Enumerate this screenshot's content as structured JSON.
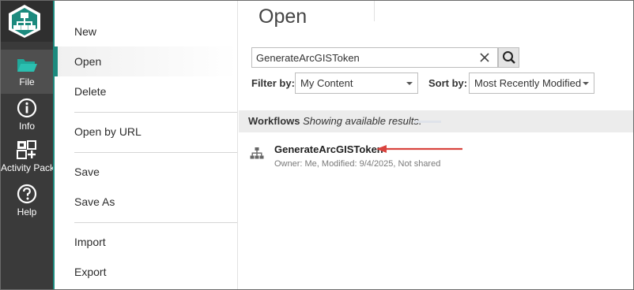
{
  "rail": {
    "items": [
      {
        "label": "File",
        "icon": "folder-icon"
      },
      {
        "label": "Info",
        "icon": "info-icon"
      },
      {
        "label": "Activity Packs",
        "icon": "activity-packs-icon"
      },
      {
        "label": "Help",
        "icon": "help-icon"
      }
    ],
    "logo_icon": "app-logo-icon",
    "accent_color": "#1c8a7e",
    "background_color": "#3a3a3a"
  },
  "menu": {
    "items": [
      {
        "label": "New"
      },
      {
        "label": "Open"
      },
      {
        "label": "Delete"
      },
      {
        "label": "Open by URL"
      },
      {
        "label": "Save"
      },
      {
        "label": "Save As"
      },
      {
        "label": "Import"
      },
      {
        "label": "Export"
      }
    ],
    "active": "Open"
  },
  "panel": {
    "title": "Open",
    "search": {
      "value": "GenerateArcGISToken"
    },
    "filter": {
      "label": "Filter by:",
      "value": "My Content"
    },
    "sort": {
      "label": "Sort by:",
      "value": "Most Recently Modified"
    },
    "results": {
      "heading": "Workflows",
      "status": "Showing available results."
    },
    "workflows": [
      {
        "name": "GenerateArcGISToken",
        "meta": "Owner: Me, Modified: 9/4/2025, Not shared",
        "icon": "workflow-icon"
      }
    ],
    "annotation_arrow_color": "#d9443f"
  }
}
